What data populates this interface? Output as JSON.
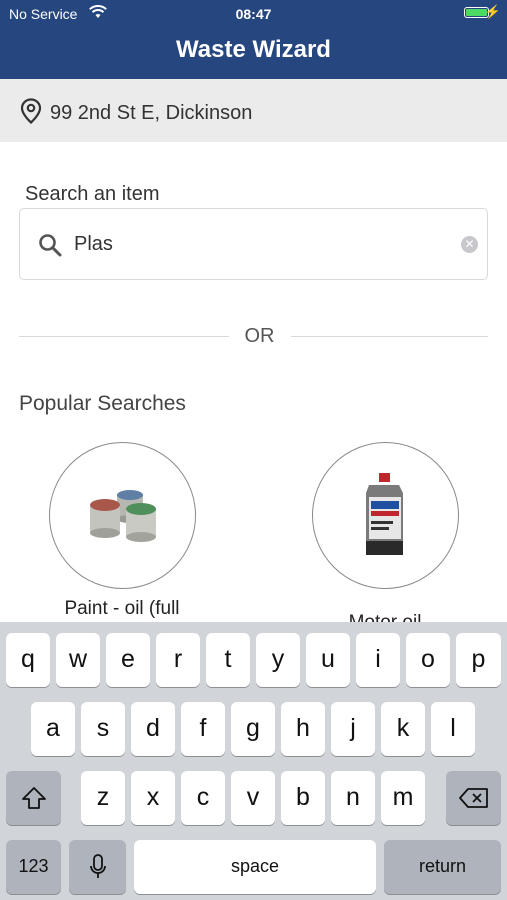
{
  "status_bar": {
    "carrier": "No Service",
    "time": "08:47"
  },
  "header": {
    "title": "Waste Wizard"
  },
  "location": {
    "address": "99 2nd St E, Dickinson"
  },
  "search": {
    "label": "Search an item",
    "value": "Plas"
  },
  "divider": {
    "text": "OR"
  },
  "popular": {
    "heading": "Popular Searches",
    "items": [
      {
        "label": "Paint - oil (full",
        "icon": "paint-cans-icon"
      },
      {
        "label": "Motor oil",
        "icon": "motor-oil-bottle-icon"
      }
    ]
  },
  "keyboard": {
    "row1": [
      "q",
      "w",
      "e",
      "r",
      "t",
      "y",
      "u",
      "i",
      "o",
      "p"
    ],
    "row2": [
      "a",
      "s",
      "d",
      "f",
      "g",
      "h",
      "j",
      "k",
      "l"
    ],
    "row3": [
      "z",
      "x",
      "c",
      "v",
      "b",
      "n",
      "m"
    ],
    "numbers_label": "123",
    "space_label": "space",
    "return_label": "return"
  },
  "colors": {
    "header_bg": "#25467f",
    "battery": "#4cd964",
    "keyboard_bg": "#d1d4d9"
  }
}
